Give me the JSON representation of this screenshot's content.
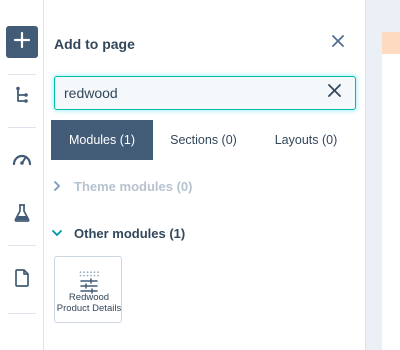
{
  "rail": {
    "items": [
      {
        "icon": "plus-icon"
      },
      {
        "icon": "tree-structure-icon"
      },
      {
        "icon": "gauge-icon"
      },
      {
        "icon": "flask-icon"
      },
      {
        "icon": "document-icon"
      }
    ]
  },
  "panel": {
    "title": "Add to page",
    "close_icon": "close-icon"
  },
  "search": {
    "value": "redwood",
    "clear_icon": "clear-icon"
  },
  "tabs": [
    {
      "label": "Modules (1)",
      "active": true
    },
    {
      "label": "Sections (0)",
      "active": false
    },
    {
      "label": "Layouts (0)",
      "active": false
    }
  ],
  "groups": {
    "theme": {
      "label": "Theme modules (0)",
      "expanded": false
    },
    "other": {
      "label": "Other modules (1)",
      "expanded": true
    }
  },
  "modules": [
    {
      "label": "Redwood Product Details",
      "icon": "sliders-icon"
    }
  ],
  "colors": {
    "accent_dark": "#425b76",
    "focus_teal": "#00bda5",
    "text": "#33475b",
    "muted_text": "#b7c3d0",
    "editor_bg": "#eaf0f6",
    "editor_header": "#fedac0"
  }
}
